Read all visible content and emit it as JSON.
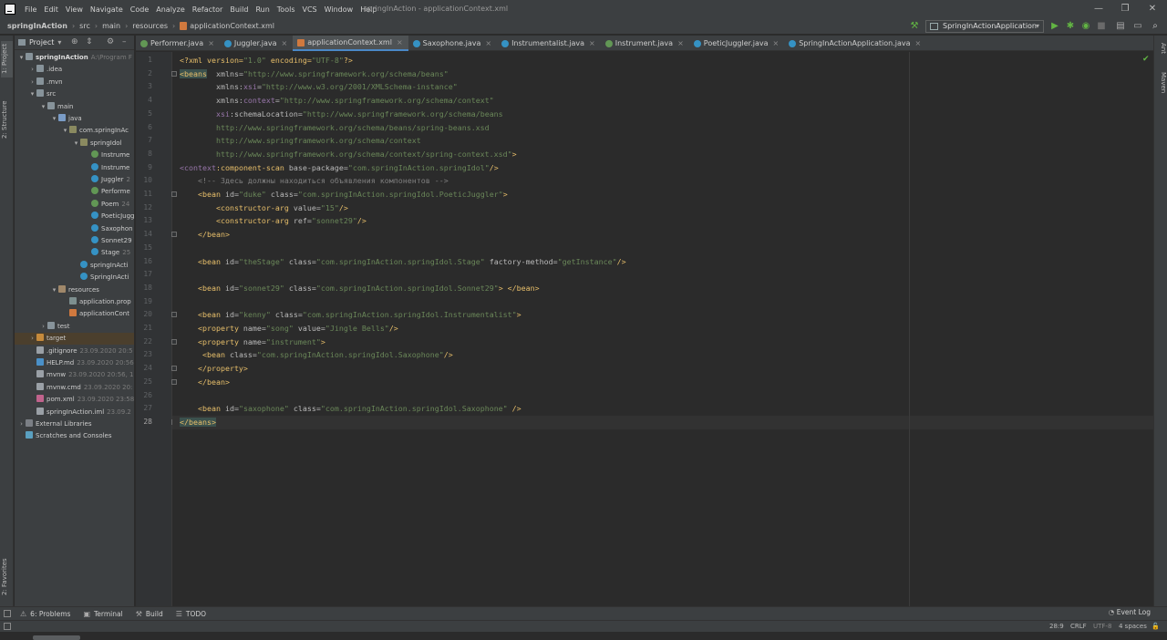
{
  "app": {
    "window_title": "springInAction - applicationContext.xml",
    "menu": [
      "File",
      "Edit",
      "View",
      "Navigate",
      "Code",
      "Analyze",
      "Refactor",
      "Build",
      "Run",
      "Tools",
      "VCS",
      "Window",
      "Help"
    ]
  },
  "breadcrumb": [
    "springInAction",
    "src",
    "main",
    "resources",
    "applicationContext.xml"
  ],
  "toolbar": {
    "run_config": "SpringInActionApplication"
  },
  "left_tool_tabs": {
    "project": "1: Project",
    "structure": "2: Structure",
    "favorites": "2: Favorites"
  },
  "right_tool_tabs": {
    "ant": "Ant",
    "maven": "Maven"
  },
  "project_panel": {
    "title": "Project"
  },
  "tree": [
    {
      "label": "springInAction",
      "meta": "A:\\Program F",
      "icon": "folder",
      "arrow": "down",
      "depth": 0,
      "bold": true
    },
    {
      "label": ".idea",
      "meta": "",
      "icon": "folder",
      "arrow": "right",
      "depth": 1
    },
    {
      "label": ".mvn",
      "meta": "",
      "icon": "folder",
      "arrow": "right",
      "depth": 1
    },
    {
      "label": "src",
      "meta": "",
      "icon": "folder",
      "arrow": "down",
      "depth": 1
    },
    {
      "label": "main",
      "meta": "",
      "icon": "folder",
      "arrow": "down",
      "depth": 2
    },
    {
      "label": "java",
      "meta": "",
      "icon": "folder-src",
      "arrow": "down",
      "depth": 3
    },
    {
      "label": "com.springInAc",
      "meta": "",
      "icon": "pkg",
      "arrow": "down",
      "depth": 4
    },
    {
      "label": "springIdol",
      "meta": "",
      "icon": "pkg",
      "arrow": "down",
      "depth": 5
    },
    {
      "label": "Instrume",
      "meta": "",
      "icon": "iface",
      "arrow": "",
      "depth": 6
    },
    {
      "label": "Instrume",
      "meta": "",
      "icon": "class",
      "arrow": "",
      "depth": 6
    },
    {
      "label": "Juggler",
      "meta": "2",
      "icon": "class",
      "arrow": "",
      "depth": 6
    },
    {
      "label": "Performe",
      "meta": "",
      "icon": "iface",
      "arrow": "",
      "depth": 6
    },
    {
      "label": "Poem",
      "meta": "24",
      "icon": "iface",
      "arrow": "",
      "depth": 6
    },
    {
      "label": "PoeticJugg",
      "meta": "",
      "icon": "class",
      "arrow": "",
      "depth": 6
    },
    {
      "label": "Saxophon",
      "meta": "",
      "icon": "class",
      "arrow": "",
      "depth": 6
    },
    {
      "label": "Sonnet29",
      "meta": "",
      "icon": "class",
      "arrow": "",
      "depth": 6
    },
    {
      "label": "Stage",
      "meta": "25",
      "icon": "class",
      "arrow": "",
      "depth": 6
    },
    {
      "label": "springInActi",
      "meta": "",
      "icon": "class",
      "arrow": "",
      "depth": 5
    },
    {
      "label": "SpringInActi",
      "meta": "",
      "icon": "class",
      "arrow": "",
      "depth": 5
    },
    {
      "label": "resources",
      "meta": "",
      "icon": "folder-res",
      "arrow": "down",
      "depth": 3
    },
    {
      "label": "application.prop",
      "meta": "",
      "icon": "props",
      "arrow": "",
      "depth": 4
    },
    {
      "label": "applicationCont",
      "meta": "",
      "icon": "xml",
      "arrow": "",
      "depth": 4
    },
    {
      "label": "test",
      "meta": "",
      "icon": "folder",
      "arrow": "right",
      "depth": 2
    },
    {
      "label": "target",
      "meta": "",
      "icon": "folder-target",
      "arrow": "right",
      "depth": 1,
      "selected": true
    },
    {
      "label": ".gitignore",
      "meta": "23.09.2020 20:5",
      "icon": "file",
      "arrow": "",
      "depth": 1
    },
    {
      "label": "HELP.md",
      "meta": "23.09.2020 20:56",
      "icon": "md",
      "arrow": "",
      "depth": 1
    },
    {
      "label": "mvnw",
      "meta": "23.09.2020 20:56, 10",
      "icon": "file",
      "arrow": "",
      "depth": 1
    },
    {
      "label": "mvnw.cmd",
      "meta": "23.09.2020 20:",
      "icon": "file",
      "arrow": "",
      "depth": 1
    },
    {
      "label": "pom.xml",
      "meta": "23.09.2020 23:58",
      "icon": "m",
      "arrow": "",
      "depth": 1
    },
    {
      "label": "springInAction.iml",
      "meta": "23.09.2",
      "icon": "file",
      "arrow": "",
      "depth": 1
    },
    {
      "label": "External Libraries",
      "meta": "",
      "icon": "lib",
      "arrow": "right",
      "depth": 0
    },
    {
      "label": "Scratches and Consoles",
      "meta": "",
      "icon": "scratch",
      "arrow": "",
      "depth": 0
    }
  ],
  "tabs": [
    {
      "label": "Performer.java",
      "icon": "iface",
      "active": false
    },
    {
      "label": "Juggler.java",
      "icon": "class",
      "active": false
    },
    {
      "label": "applicationContext.xml",
      "icon": "xml",
      "active": true
    },
    {
      "label": "Saxophone.java",
      "icon": "class",
      "active": false
    },
    {
      "label": "Instrumentalist.java",
      "icon": "class",
      "active": false
    },
    {
      "label": "Instrument.java",
      "icon": "iface",
      "active": false
    },
    {
      "label": "PoeticJuggler.java",
      "icon": "class",
      "active": false
    },
    {
      "label": "SpringInActionApplication.java",
      "icon": "class",
      "active": false
    }
  ],
  "code_lines": [
    [
      [
        "pi",
        "<?xml version="
      ],
      [
        "av",
        "\"1.0\""
      ],
      [
        "pi",
        " encoding="
      ],
      [
        "av",
        "\"UTF-8\""
      ],
      [
        "pi",
        "?>"
      ]
    ],
    [
      [
        "tg hl",
        "<beans"
      ],
      [
        "at",
        "  xmlns="
      ],
      [
        "av",
        "\"http://www.springframework.org/schema/beans\""
      ]
    ],
    [
      [
        "at",
        "        xmlns:"
      ],
      [
        "ns",
        "xsi"
      ],
      [
        "at",
        "="
      ],
      [
        "av",
        "\"http://www.w3.org/2001/XMLSchema-instance\""
      ]
    ],
    [
      [
        "at",
        "        xmlns:"
      ],
      [
        "ns",
        "context"
      ],
      [
        "at",
        "="
      ],
      [
        "av",
        "\"http://www.springframework.org/schema/context\""
      ]
    ],
    [
      [
        "ns",
        "        xsi"
      ],
      [
        "at",
        ":schemaLocation="
      ],
      [
        "av",
        "\"http://www.springframework.org/schema/beans"
      ]
    ],
    [
      [
        "av",
        "        http://www.springframework.org/schema/beans/spring-beans.xsd"
      ]
    ],
    [
      [
        "av",
        "        http://www.springframework.org/schema/context"
      ]
    ],
    [
      [
        "av",
        "        http://www.springframework.org/schema/context/spring-context.xsd\""
      ],
      [
        "tg",
        ">"
      ]
    ],
    [
      [
        "ns",
        "<context"
      ],
      [
        "tg",
        ":component-scan"
      ],
      [
        "at",
        " base-package="
      ],
      [
        "av",
        "\"com.springInAction.springIdol\""
      ],
      [
        "tg",
        "/>"
      ]
    ],
    [
      [
        "cm",
        "    <!-- Здесь должны находиться объявления компонентов -->"
      ]
    ],
    [
      [
        "tg",
        "    <bean"
      ],
      [
        "at",
        " id="
      ],
      [
        "av",
        "\"duke\""
      ],
      [
        "at",
        " class="
      ],
      [
        "av",
        "\"com.springInAction.springIdol.PoeticJuggler\""
      ],
      [
        "tg",
        ">"
      ]
    ],
    [
      [
        "tg",
        "        <constructor-arg"
      ],
      [
        "at",
        " value="
      ],
      [
        "av",
        "\"15\""
      ],
      [
        "tg",
        "/>"
      ]
    ],
    [
      [
        "tg",
        "        <constructor-arg"
      ],
      [
        "at",
        " ref="
      ],
      [
        "av",
        "\"sonnet29\""
      ],
      [
        "tg",
        "/>"
      ]
    ],
    [
      [
        "tg",
        "    </bean>"
      ]
    ],
    [],
    [
      [
        "tg",
        "    <bean"
      ],
      [
        "at",
        " id="
      ],
      [
        "av",
        "\"theStage\""
      ],
      [
        "at",
        " class="
      ],
      [
        "av",
        "\"com.springInAction.springIdol.Stage\""
      ],
      [
        "at",
        " factory-method="
      ],
      [
        "av",
        "\"getInstance\""
      ],
      [
        "tg",
        "/>"
      ]
    ],
    [],
    [
      [
        "tg",
        "    <bean"
      ],
      [
        "at",
        " id="
      ],
      [
        "av",
        "\"sonnet29\""
      ],
      [
        "at",
        " class="
      ],
      [
        "av",
        "\"com.springInAction.springIdol.Sonnet29\""
      ],
      [
        "tg",
        "> </bean>"
      ]
    ],
    [],
    [
      [
        "tg",
        "    <bean"
      ],
      [
        "at",
        " id="
      ],
      [
        "av",
        "\"kenny\""
      ],
      [
        "at",
        " class="
      ],
      [
        "av",
        "\"com.springInAction.springIdol.Instrumentalist\""
      ],
      [
        "tg",
        ">"
      ]
    ],
    [
      [
        "tg",
        "    <property"
      ],
      [
        "at",
        " name="
      ],
      [
        "av",
        "\"song\""
      ],
      [
        "at",
        " value="
      ],
      [
        "av",
        "\"Jingle Bells\""
      ],
      [
        "tg",
        "/>"
      ]
    ],
    [
      [
        "tg",
        "    <property"
      ],
      [
        "at",
        " name="
      ],
      [
        "av",
        "\"instrument\""
      ],
      [
        "tg",
        ">"
      ]
    ],
    [
      [
        "tg",
        "     <bean"
      ],
      [
        "at",
        " class="
      ],
      [
        "av",
        "\"com.springInAction.springIdol.Saxophone\""
      ],
      [
        "tg",
        "/>"
      ]
    ],
    [
      [
        "tg",
        "    </property>"
      ]
    ],
    [
      [
        "tg",
        "    </bean>"
      ]
    ],
    [],
    [
      [
        "tg",
        "    <bean"
      ],
      [
        "at",
        " id="
      ],
      [
        "av",
        "\"saxophone\""
      ],
      [
        "at",
        " class="
      ],
      [
        "av",
        "\"com.springInAction.springIdol.Saxophone\""
      ],
      [
        "tg",
        " />"
      ]
    ],
    [
      [
        "tg hl",
        "</beans>"
      ]
    ]
  ],
  "current_line": 28,
  "bottom_tabs": [
    {
      "label": "6: Problems",
      "icon": "⚠"
    },
    {
      "label": "Terminal",
      "icon": "▣"
    },
    {
      "label": "Build",
      "icon": "⚒"
    },
    {
      "label": "TODO",
      "icon": "☰"
    }
  ],
  "event_log": "Event Log",
  "status": {
    "position": "28:9",
    "line_sep": "CRLF",
    "encoding": "UTF-8",
    "indent": "4 spaces"
  },
  "colors": {
    "accent": "#4a88c7",
    "run": "#62b543",
    "selection": "#4b3f2d"
  }
}
